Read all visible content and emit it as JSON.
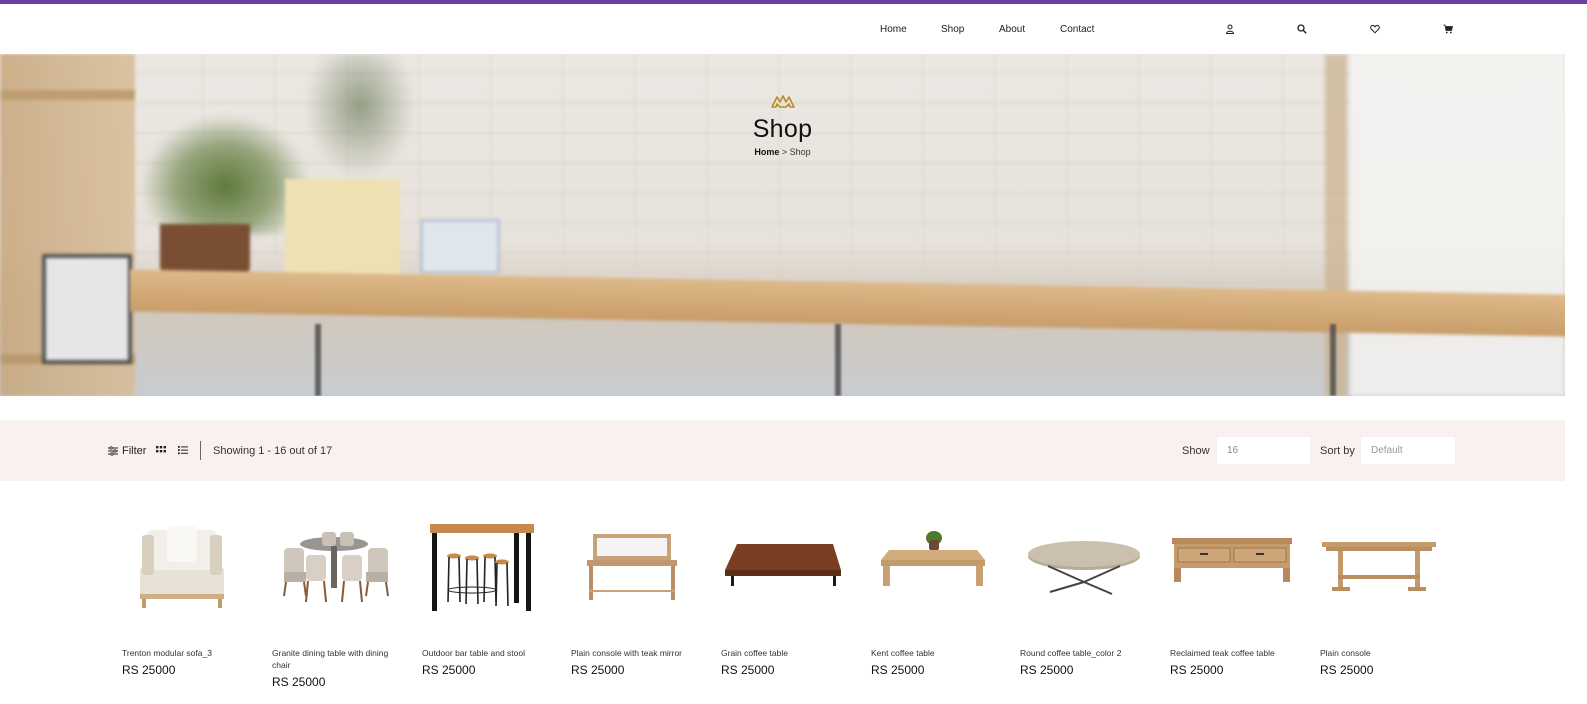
{
  "nav": {
    "items": [
      "Home",
      "Shop",
      "About",
      "Contact"
    ]
  },
  "header_icons": [
    "user-icon",
    "search-icon",
    "heart-icon",
    "cart-icon"
  ],
  "hero": {
    "title": "Shop",
    "breadcrumb_home": "Home",
    "breadcrumb_sep": " > ",
    "breadcrumb_current": "Shop"
  },
  "toolbar": {
    "filter_label": "Filter",
    "showing_text": "Showing 1 - 16 out of 17",
    "show_label": "Show",
    "show_value": "16",
    "sort_label": "Sort by",
    "sort_value": "Default"
  },
  "products": [
    {
      "name": "Trenton modular sofa_3",
      "price": "RS 25000"
    },
    {
      "name": "Granite dining table with dining chair",
      "price": "RS 25000"
    },
    {
      "name": "Outdoor bar table and stool",
      "price": "RS 25000"
    },
    {
      "name": "Plain console with teak mirror",
      "price": "RS 25000"
    },
    {
      "name": "Grain coffee table",
      "price": "RS 25000"
    },
    {
      "name": "Kent coffee table",
      "price": "RS 25000"
    },
    {
      "name": "Round coffee table_color 2",
      "price": "RS 25000"
    },
    {
      "name": "Reclaimed teak coffee table",
      "price": "RS 25000"
    },
    {
      "name": "Plain console",
      "price": "RS 25000"
    }
  ],
  "colors": {
    "accent_bar": "#6b3fa0",
    "filter_bar_bg": "#f8f1f0",
    "logo_gold": "#b88e2f"
  }
}
